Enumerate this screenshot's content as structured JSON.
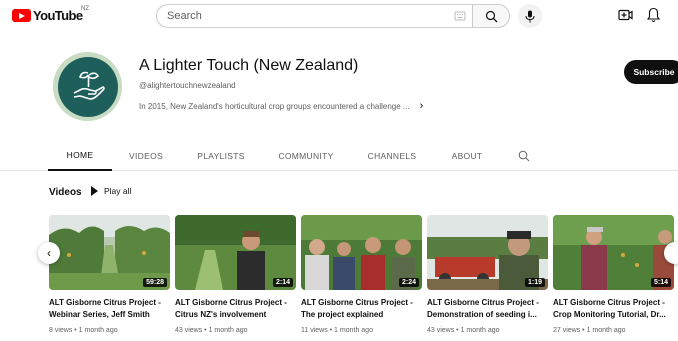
{
  "header": {
    "logo_text": "YouTube",
    "logo_region": "NZ",
    "search_placeholder": "Search"
  },
  "channel": {
    "title": "A Lighter Touch (New Zealand)",
    "handle": "@alightertouchnewzealand",
    "description": "In 2015, New Zealand's horticultural crop groups encountered a challenge ...",
    "subscribe_label": "Subscribe"
  },
  "tabs": [
    {
      "label": "HOME",
      "active": true
    },
    {
      "label": "VIDEOS"
    },
    {
      "label": "PLAYLISTS"
    },
    {
      "label": "COMMUNITY"
    },
    {
      "label": "CHANNELS"
    },
    {
      "label": "ABOUT"
    }
  ],
  "section": {
    "title": "Videos",
    "play_all": "Play all"
  },
  "videos": [
    {
      "title": "ALT Gisborne Citrus Project - Webinar Series, Jeff Smith",
      "duration": "59:28",
      "meta": "8 views • 1 month ago"
    },
    {
      "title": "ALT Gisborne Citrus Project - Citrus NZ's involvement",
      "duration": "2:14",
      "meta": "43 views • 1 month ago"
    },
    {
      "title": "ALT Gisborne Citrus Project - The project explained",
      "duration": "2:24",
      "meta": "11 views • 1 month ago"
    },
    {
      "title": "ALT Gisborne Citrus Project - Demonstration of seeding i...",
      "duration": "1:19",
      "meta": "43 views • 1 month ago"
    },
    {
      "title": "ALT Gisborne Citrus Project - Crop Monitoring Tutorial, Dr...",
      "duration": "5:14",
      "meta": "27 views • 1 month ago"
    }
  ],
  "colors": {
    "brand_red": "#ff0000",
    "avatar_teal": "#1f5f5b",
    "text_primary": "#0f0f0f",
    "text_secondary": "#606060"
  },
  "icons": [
    "menu-icon",
    "search-icon",
    "keyboard-icon",
    "mic-icon",
    "create-icon",
    "bell-icon",
    "chevron-right-icon",
    "play-icon",
    "chevron-left-icon"
  ]
}
